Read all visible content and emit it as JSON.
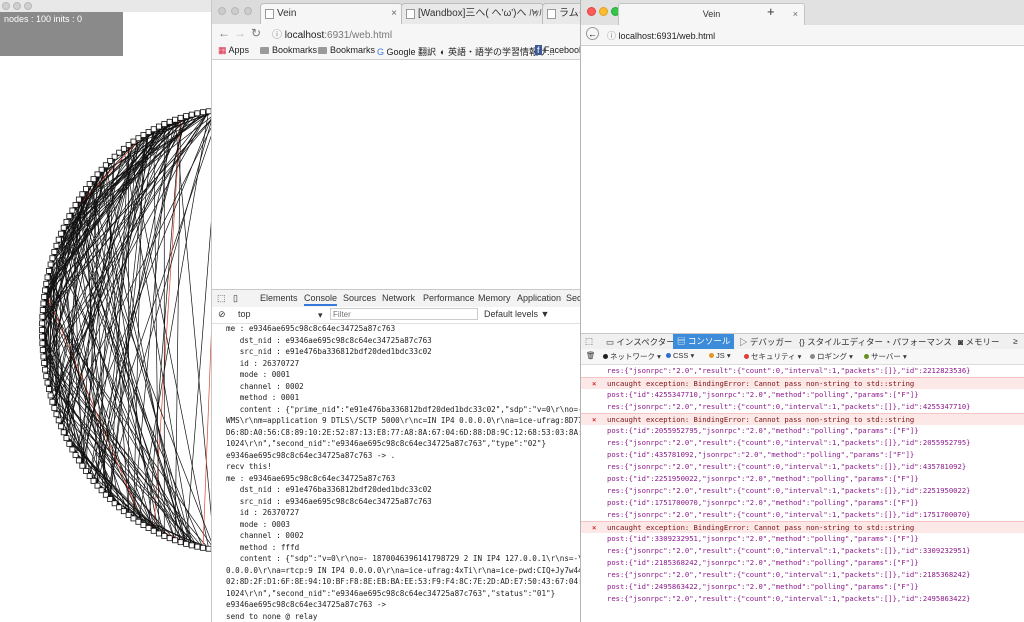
{
  "graph_window": {
    "stats_text": "nodes : 100  inits : 0"
  },
  "chrome": {
    "tabs": [
      {
        "title": "Vein"
      },
      {
        "title": "[Wandbox]三へ( へ'ω')へ ﾊｯﾊｯ"
      },
      {
        "title": "ラムダ"
      }
    ],
    "url_host": "localhost",
    "url_rest": ":6931/web.html",
    "bookmarks": [
      "Apps",
      "Bookmarks",
      "Bookmarks",
      "Google 翻訳",
      "英語・語学の学習情報サ...",
      "Facebook"
    ],
    "devtools": {
      "tabs": [
        "Elements",
        "Console",
        "Sources",
        "Network",
        "Performance",
        "Memory",
        "Application",
        "Sec"
      ],
      "active_tab": "Console",
      "context": "top",
      "filter_placeholder": "Filter",
      "levels": "Default levels ▼",
      "log_lines": [
        "me : e9346ae695c98c8c64ec34725a87c763",
        "   dst_nid : e9346ae695c98c8c64ec34725a87c763",
        "   src_nid : e91e476ba336812bdf20ded1bdc33c02",
        "   id : 26370727",
        "   mode : 0001",
        "   channel : 0002",
        "   method : 0001",
        "   content : {\"prime_nid\":\"e91e476ba336812bdf20ded1bdc33c02\",\"sdp\":\"v=0\\r\\no=- 8007248431",
        "WMS\\r\\nm=application 9 DTLS\\/SCTP 5000\\r\\nc=IN IP4 0.0.0.0\\r\\na=ice-ufrag:8D77\\r\\na=ice",
        "D6:8D:A0:56:C8:89:10:2E:52:87:13:E8:77:A8:8A:67:04:6D:88:D8:9C:12:68:53:03:8A:FE:3A:F4",
        "1024\\r\\n\",\"second_nid\":\"e9346ae695c98c8c64ec34725a87c763\",\"type\":\"02\"}",
        "e9346ae695c98c8c64ec34725a87c763 -> .",
        "recv this!",
        "me : e9346ae695c98c8c64ec34725a87c763",
        "   dst_nid : e91e476ba336812bdf20ded1bdc33c02",
        "   src_nid : e9346ae695c98c8c64ec34725a87c763",
        "   id : 26370727",
        "   mode : 0003",
        "   channel : 0002",
        "   method : fffd",
        "   content : {\"sdp\":\"v=0\\r\\no=- 1870046396141798729 2 IN IP4 127.0.0.1\\r\\ns=-\\r\\nt=0 0\\",
        "0.0.0.0\\r\\na=rtcp:9 IN IP4 0.0.0.0\\r\\na=ice-ufrag:4xTi\\r\\na=ice-pwd:CIQ+Jy7w44YRM9wCnbDBTZVw\\r\\na=ice-",
        "02:8D:2F:D1:6F:8E:94:10:BF:F8:8E:EB:BA:EE:53:F9:F4:8C:7E:2D:AD:E7:50:43:67:04:9C:AC:9F",
        "1024\\r\\n\",\"second_nid\":\"e9346ae695c98c8c64ec34725a87c763\",\"status\":\"01\"}",
        "e9346ae695c98c8c64ec34725a87c763 ->",
        "send to none @ relay"
      ],
      "prompt": ">"
    }
  },
  "firefox": {
    "tab_title": "Vein",
    "new_tab_label": "+",
    "url_host": "localhost",
    "url_rest": ":6931/web.html",
    "devtools": {
      "tabs": [
        "インスペクター",
        "コンソール",
        "デバッガー",
        "スタイルエディター",
        "パフォーマンス",
        "メモリー"
      ],
      "active_tab": "コンソール",
      "filters": [
        "ネットワーク",
        "CSS",
        "JS",
        "セキュリティ",
        "ロギング",
        "サーバー"
      ],
      "filter_colors": [
        "#1f1f1f",
        "#2f6fc8",
        "#e09a22",
        "#e13b3b",
        "#888888",
        "#6b8e23"
      ],
      "lines": [
        {
          "type": "log",
          "text": "res:{\"jsonrpc\":\"2.0\",\"result\":{\"count\":0,\"interval\":1,\"packets\":[]},\"id\":2212823536}"
        },
        {
          "type": "error",
          "text": "uncaught exception: BindingError: Cannot pass non-string to std::string"
        },
        {
          "type": "log",
          "text": "post:{\"id\":4255347710,\"jsonrpc\":\"2.0\",\"method\":\"polling\",\"params\":[\"F\"]}"
        },
        {
          "type": "log",
          "text": "res:{\"jsonrpc\":\"2.0\",\"result\":{\"count\":0,\"interval\":1,\"packets\":[]},\"id\":4255347710}"
        },
        {
          "type": "error",
          "text": "uncaught exception: BindingError: Cannot pass non-string to std::string"
        },
        {
          "type": "log",
          "text": "post:{\"id\":2055952795,\"jsonrpc\":\"2.0\",\"method\":\"polling\",\"params\":[\"F\"]}"
        },
        {
          "type": "log",
          "text": "res:{\"jsonrpc\":\"2.0\",\"result\":{\"count\":0,\"interval\":1,\"packets\":[]},\"id\":2055952795}"
        },
        {
          "type": "log",
          "text": "post:{\"id\":435781092,\"jsonrpc\":\"2.0\",\"method\":\"polling\",\"params\":[\"F\"]}"
        },
        {
          "type": "log",
          "text": "res:{\"jsonrpc\":\"2.0\",\"result\":{\"count\":0,\"interval\":1,\"packets\":[]},\"id\":435781092}"
        },
        {
          "type": "log",
          "text": "post:{\"id\":2251950022,\"jsonrpc\":\"2.0\",\"method\":\"polling\",\"params\":[\"F\"]}"
        },
        {
          "type": "log",
          "text": "res:{\"jsonrpc\":\"2.0\",\"result\":{\"count\":0,\"interval\":1,\"packets\":[]},\"id\":2251950022}"
        },
        {
          "type": "log",
          "text": "post:{\"id\":1751700070,\"jsonrpc\":\"2.0\",\"method\":\"polling\",\"params\":[\"F\"]}"
        },
        {
          "type": "log",
          "text": "res:{\"jsonrpc\":\"2.0\",\"result\":{\"count\":0,\"interval\":1,\"packets\":[]},\"id\":1751700070}"
        },
        {
          "type": "error",
          "text": "uncaught exception: BindingError: Cannot pass non-string to std::string"
        },
        {
          "type": "log",
          "text": "post:{\"id\":3309232951,\"jsonrpc\":\"2.0\",\"method\":\"polling\",\"params\":[\"F\"]}"
        },
        {
          "type": "log",
          "text": "res:{\"jsonrpc\":\"2.0\",\"result\":{\"count\":0,\"interval\":1,\"packets\":[]},\"id\":3309232951}"
        },
        {
          "type": "log",
          "text": "post:{\"id\":2185368242,\"jsonrpc\":\"2.0\",\"method\":\"polling\",\"params\":[\"F\"]}"
        },
        {
          "type": "log",
          "text": "res:{\"jsonrpc\":\"2.0\",\"result\":{\"count\":0,\"interval\":1,\"packets\":[]},\"id\":2185368242}"
        },
        {
          "type": "log",
          "text": "post:{\"id\":2495863422,\"jsonrpc\":\"2.0\",\"method\":\"polling\",\"params\":[\"F\"]}"
        },
        {
          "type": "log",
          "text": "res:{\"jsonrpc\":\"2.0\",\"result\":{\"count\":0,\"interval\":1,\"packets\":[]},\"id\":2495863422}"
        }
      ]
    }
  }
}
